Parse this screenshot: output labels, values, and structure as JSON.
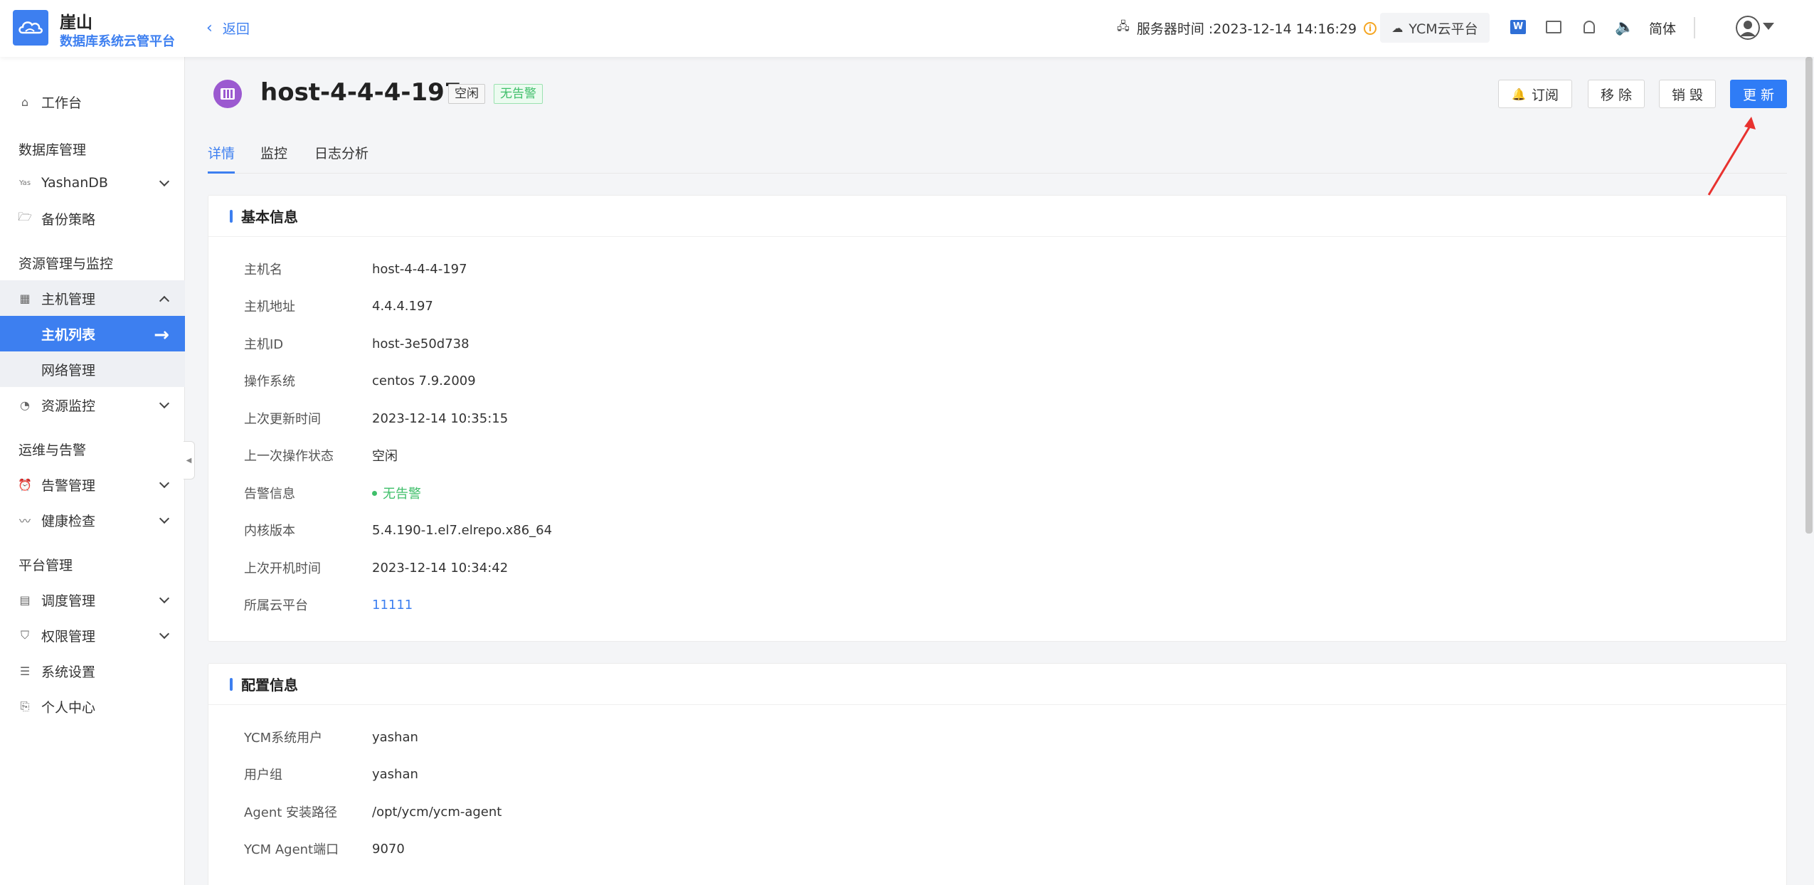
{
  "header": {
    "brand_name": "崖山",
    "brand_sub": "数据库系统云管平台",
    "back_label": "返回",
    "server_time": "服务器时间 :2023-12-14 14:16:29",
    "cloud_platform": "YCM云平台",
    "lang": "简体"
  },
  "sidebar": {
    "workbench": "工作台",
    "group_db": "数据库管理",
    "yashandb": "YashanDB",
    "yas_icon": "Yas",
    "backup": "备份策略",
    "group_res": "资源管理与监控",
    "host_mgmt": "主机管理",
    "host_list": "主机列表",
    "network": "网络管理",
    "res_monitor": "资源监控",
    "group_ops": "运维与告警",
    "alarm_mgmt": "告警管理",
    "health": "健康检查",
    "group_platform": "平台管理",
    "schedule": "调度管理",
    "permission": "权限管理",
    "settings": "系统设置",
    "personal": "个人中心"
  },
  "page": {
    "title": "host-4-4-4-197",
    "tag_idle": "空闲",
    "tag_no_alarm": "无告警",
    "btn_subscribe": "订阅",
    "btn_remove": "移 除",
    "btn_destroy": "销 毁",
    "btn_update": "更 新",
    "tabs": [
      "详情",
      "监控",
      "日志分析"
    ]
  },
  "basic": {
    "title": "基本信息",
    "rows": [
      {
        "label": "主机名",
        "value": "host-4-4-4-197"
      },
      {
        "label": "主机地址",
        "value": "4.4.4.197"
      },
      {
        "label": "主机ID",
        "value": "host-3e50d738"
      },
      {
        "label": "操作系统",
        "value": "centos 7.9.2009"
      },
      {
        "label": "上次更新时间",
        "value": "2023-12-14 10:35:15"
      },
      {
        "label": "上一次操作状态",
        "value": "空闲"
      },
      {
        "label": "告警信息",
        "value": "无告警"
      },
      {
        "label": "内核版本",
        "value": "5.4.190-1.el7.elrepo.x86_64"
      },
      {
        "label": "上次开机时间",
        "value": "2023-12-14 10:34:42"
      },
      {
        "label": "所属云平台",
        "value": "11111"
      }
    ]
  },
  "config": {
    "title": "配置信息",
    "rows": [
      {
        "label": "YCM系统用户",
        "value": "yashan"
      },
      {
        "label": "用户组",
        "value": "yashan"
      },
      {
        "label": "Agent 安装路径",
        "value": "/opt/ycm/ycm-agent"
      },
      {
        "label": "YCM Agent端口",
        "value": "9070"
      }
    ]
  },
  "colors": {
    "primary": "#3d7ff0",
    "success": "#3fbf6a",
    "annotation": "#e8322f"
  }
}
